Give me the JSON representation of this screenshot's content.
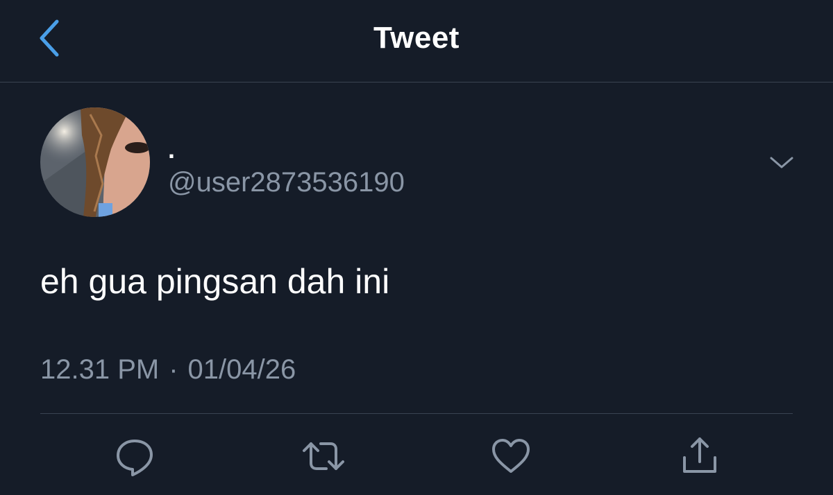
{
  "header": {
    "title": "Tweet",
    "back_icon": "chevron-left-icon"
  },
  "tweet": {
    "avatar_icon": "profile-photo",
    "display_name": ".",
    "handle": "@user2873536190",
    "menu_icon": "chevron-down-icon",
    "text": "eh gua pingsan dah ini",
    "time": "12.31 PM",
    "separator": "·",
    "date": "01/04/26"
  },
  "actions": [
    {
      "icon": "reply-icon"
    },
    {
      "icon": "retweet-icon"
    },
    {
      "icon": "like-icon"
    },
    {
      "icon": "share-icon"
    }
  ],
  "colors": {
    "background": "#151c28",
    "accent": "#4a9fe8",
    "secondary_text": "#8a96a6",
    "divider": "#3a4452"
  }
}
